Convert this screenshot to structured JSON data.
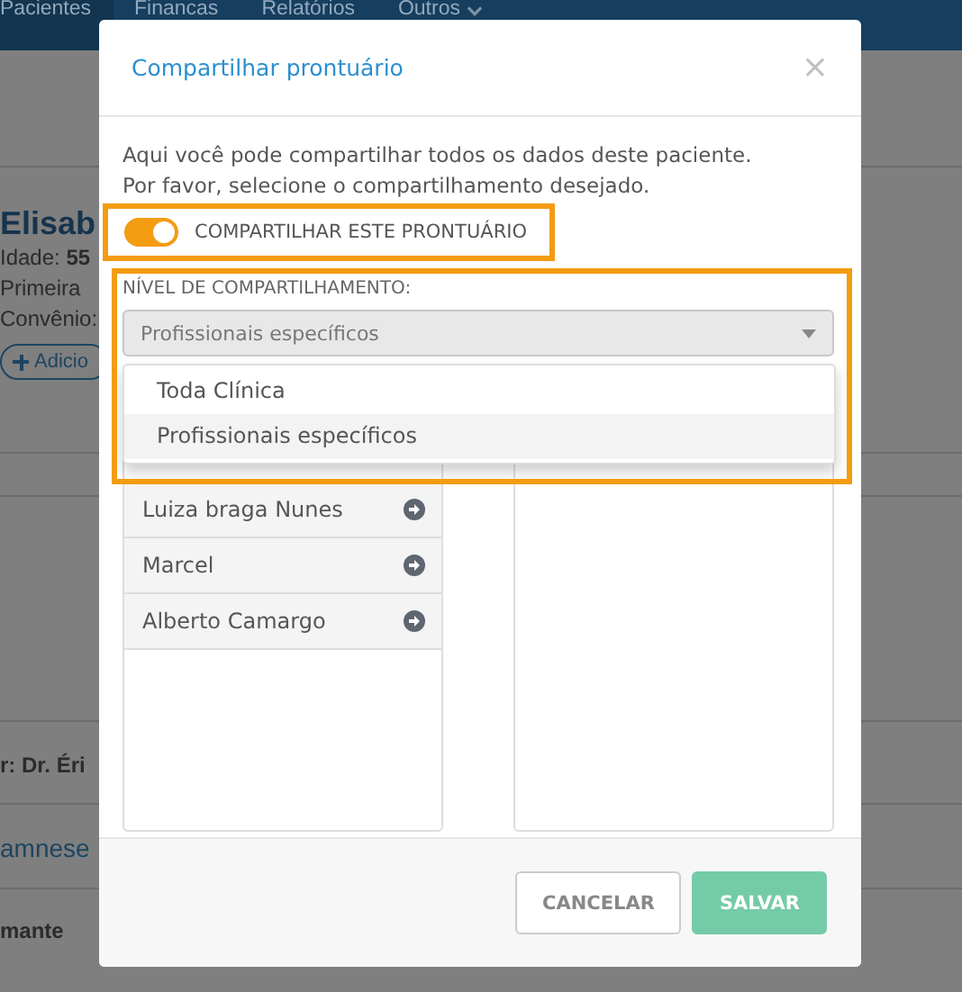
{
  "nav": {
    "items": [
      {
        "label": "Pacientes",
        "selected": true,
        "has_menu": false
      },
      {
        "label": "Financas",
        "selected": false,
        "has_menu": false
      },
      {
        "label": "Relatórios",
        "selected": false,
        "has_menu": false
      },
      {
        "label": "Outros",
        "selected": false,
        "has_menu": true
      }
    ]
  },
  "patient": {
    "name": "Elisab",
    "fields": [
      {
        "label": "Idade:",
        "value": "55"
      },
      {
        "label": "Primeira"
      },
      {
        "label": "Convênio:"
      }
    ],
    "add_button": "Adicio",
    "doctor": "r: Dr. Éri",
    "link": "amnese",
    "section": "mante"
  },
  "modal": {
    "title": "Compartilhar prontuário",
    "close": "×",
    "intro": [
      "Aqui você pode compartilhar todos os dados deste paciente.",
      "Por favor, selecione o compartilhamento desejado."
    ],
    "toggle": {
      "label": "COMPARTILHAR ESTE PRONTUÁRIO",
      "on": true,
      "highlighted": true
    },
    "level": {
      "label": "NÍVEL DE COMPARTILHAMENTO:",
      "value": "Profissionais específicos",
      "highlighted": true,
      "options": [
        {
          "label": "Toda Clínica",
          "selected": false
        },
        {
          "label": "Profissionais específicos",
          "selected": true
        }
      ]
    },
    "professionals": [
      "Luiza braga Nunes",
      "Marcel",
      "Alberto Camargo"
    ],
    "buttons": {
      "cancel": {
        "label": "CANCELAR",
        "disabled": false
      },
      "save": {
        "label": "SALVAR",
        "disabled": true
      }
    }
  }
}
